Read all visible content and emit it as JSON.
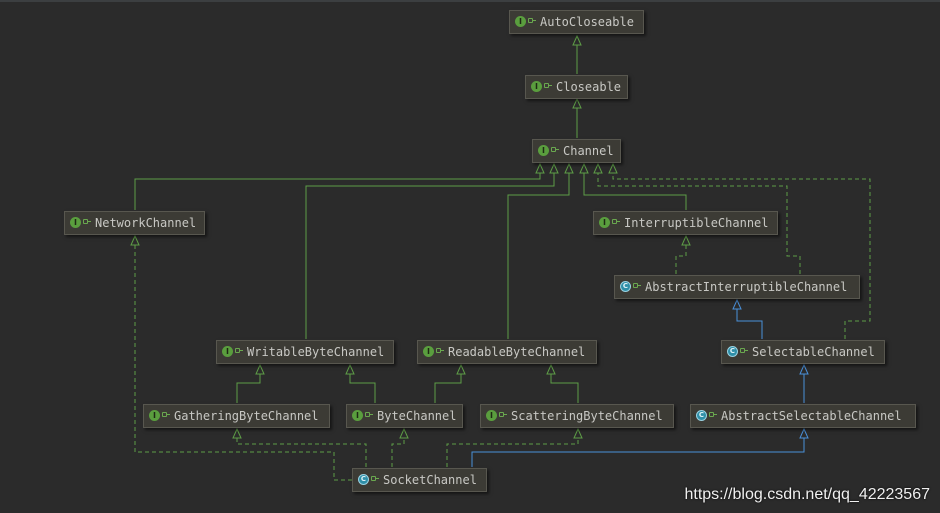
{
  "diagram": {
    "nodes": [
      {
        "id": "AutoCloseable",
        "label": "AutoCloseable",
        "kind": "interface"
      },
      {
        "id": "Closeable",
        "label": "Closeable",
        "kind": "interface"
      },
      {
        "id": "Channel",
        "label": "Channel",
        "kind": "interface"
      },
      {
        "id": "NetworkChannel",
        "label": "NetworkChannel",
        "kind": "interface"
      },
      {
        "id": "InterruptibleChannel",
        "label": "InterruptibleChannel",
        "kind": "interface"
      },
      {
        "id": "AbstractInterruptibleChannel",
        "label": "AbstractInterruptibleChannel",
        "kind": "abstract-class"
      },
      {
        "id": "WritableByteChannel",
        "label": "WritableByteChannel",
        "kind": "interface"
      },
      {
        "id": "ReadableByteChannel",
        "label": "ReadableByteChannel",
        "kind": "interface"
      },
      {
        "id": "SelectableChannel",
        "label": "SelectableChannel",
        "kind": "abstract-class"
      },
      {
        "id": "GatheringByteChannel",
        "label": "GatheringByteChannel",
        "kind": "interface"
      },
      {
        "id": "ByteChannel",
        "label": "ByteChannel",
        "kind": "interface"
      },
      {
        "id": "ScatteringByteChannel",
        "label": "ScatteringByteChannel",
        "kind": "interface"
      },
      {
        "id": "AbstractSelectableChannel",
        "label": "AbstractSelectableChannel",
        "kind": "abstract-class"
      },
      {
        "id": "SocketChannel",
        "label": "SocketChannel",
        "kind": "abstract-class"
      }
    ],
    "edges": [
      {
        "from": "Closeable",
        "to": "AutoCloseable",
        "type": "extends"
      },
      {
        "from": "Channel",
        "to": "Closeable",
        "type": "extends"
      },
      {
        "from": "NetworkChannel",
        "to": "Channel",
        "type": "extends"
      },
      {
        "from": "WritableByteChannel",
        "to": "Channel",
        "type": "extends"
      },
      {
        "from": "ReadableByteChannel",
        "to": "Channel",
        "type": "extends"
      },
      {
        "from": "InterruptibleChannel",
        "to": "Channel",
        "type": "extends"
      },
      {
        "from": "AbstractInterruptibleChannel",
        "to": "Channel",
        "type": "implements"
      },
      {
        "from": "SelectableChannel",
        "to": "Channel",
        "type": "implements"
      },
      {
        "from": "AbstractInterruptibleChannel",
        "to": "InterruptibleChannel",
        "type": "implements"
      },
      {
        "from": "SelectableChannel",
        "to": "AbstractInterruptibleChannel",
        "type": "class-extends"
      },
      {
        "from": "GatheringByteChannel",
        "to": "WritableByteChannel",
        "type": "extends"
      },
      {
        "from": "ByteChannel",
        "to": "WritableByteChannel",
        "type": "extends"
      },
      {
        "from": "ByteChannel",
        "to": "ReadableByteChannel",
        "type": "extends"
      },
      {
        "from": "ScatteringByteChannel",
        "to": "ReadableByteChannel",
        "type": "extends"
      },
      {
        "from": "AbstractSelectableChannel",
        "to": "SelectableChannel",
        "type": "class-extends"
      },
      {
        "from": "SocketChannel",
        "to": "AbstractSelectableChannel",
        "type": "class-extends"
      },
      {
        "from": "SocketChannel",
        "to": "GatheringByteChannel",
        "type": "implements"
      },
      {
        "from": "SocketChannel",
        "to": "ByteChannel",
        "type": "implements"
      },
      {
        "from": "SocketChannel",
        "to": "ScatteringByteChannel",
        "type": "implements"
      },
      {
        "from": "SocketChannel",
        "to": "NetworkChannel",
        "type": "implements"
      }
    ],
    "colors": {
      "background": "#2b2b2b",
      "interface_edge": "#5e9e47",
      "class_extends_edge": "#4a90d9",
      "node_fill": "#3c3b35",
      "node_text": "#c8c8c4"
    }
  },
  "watermark": "https://blog.csdn.net/qq_42223567"
}
